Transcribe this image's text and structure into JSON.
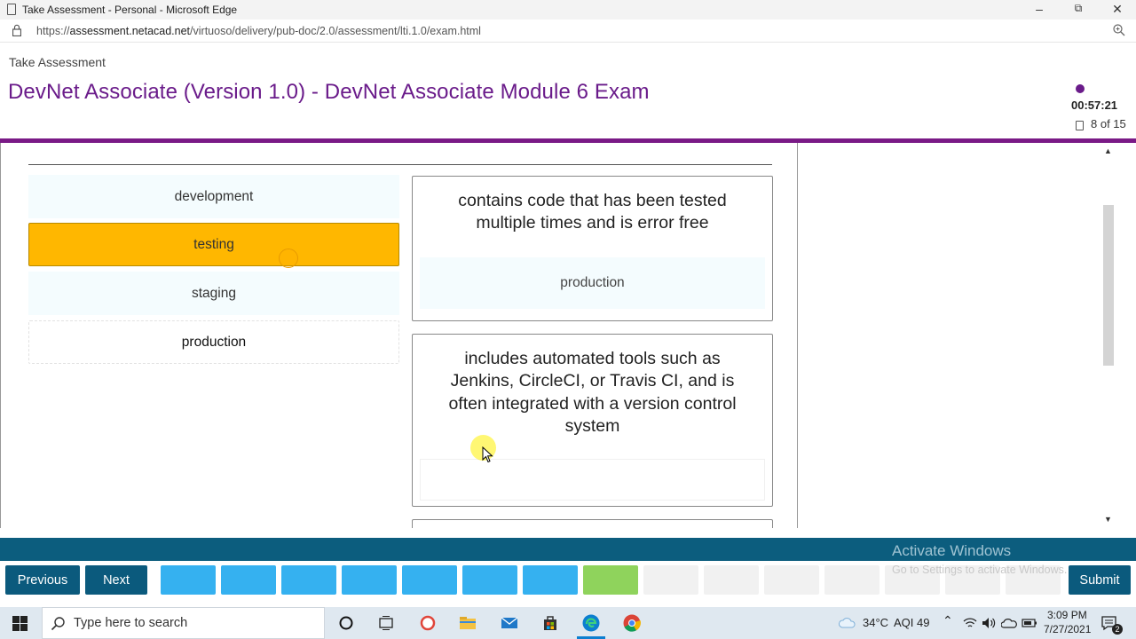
{
  "browser": {
    "window_title": "Take Assessment - Personal - Microsoft Edge",
    "url_prefix": "https://",
    "url_domain": "assessment.netacad.net",
    "url_path": "/virtuoso/delivery/pub-doc/2.0/assessment/lti.1.0/exam.html"
  },
  "header": {
    "page_tag": "Take Assessment",
    "exam_title": "DevNet Associate (Version 1.0) - DevNet Associate Module 6 Exam",
    "timer": "00:57:21",
    "counter": "8 of 15",
    "accent_color": "#7a1a86"
  },
  "options": [
    {
      "label": "development",
      "state": "available"
    },
    {
      "label": "testing",
      "state": "selected"
    },
    {
      "label": "staging",
      "state": "available"
    },
    {
      "label": "production",
      "state": "placed"
    }
  ],
  "targets": [
    {
      "description": "contains code that has been tested multiple times and is error free",
      "answer": "production"
    },
    {
      "description": "includes automated tools such as Jenkins, CircleCI, or Travis CI, and is often integrated with a version control system",
      "answer": ""
    }
  ],
  "footer": {
    "previous_label": "Previous",
    "next_label": "Next",
    "submit_label": "Submit",
    "question_states": [
      "answered",
      "answered",
      "answered",
      "answered",
      "answered",
      "answered",
      "answered",
      "current",
      "unanswered",
      "unanswered",
      "unanswered",
      "unanswered",
      "unanswered",
      "unanswered",
      "unanswered"
    ],
    "watermark_title": "Activate Windows",
    "watermark_sub": "Go to Settings to activate Windows."
  },
  "taskbar": {
    "search_placeholder": "Type here to search",
    "temperature": "34°C",
    "aqi": "AQI 49",
    "time": "3:09 PM",
    "date": "7/27/2021",
    "notification_count": "2"
  }
}
